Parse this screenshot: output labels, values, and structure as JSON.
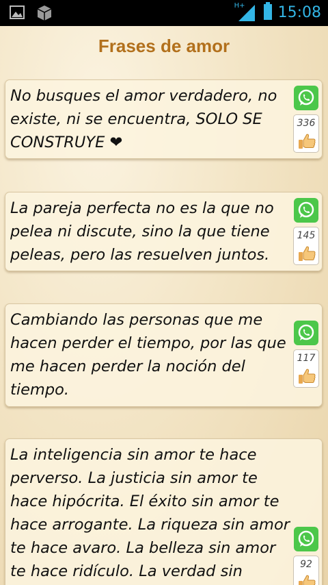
{
  "status_bar": {
    "time": "15:08",
    "network": "H+",
    "icons": [
      "image-icon",
      "box-icon",
      "network-h-plus-icon",
      "signal-icon",
      "battery-icon"
    ]
  },
  "title": "Frases de amor",
  "colors": {
    "title": "#b2701c",
    "whatsapp": "#4cc74a",
    "time": "#33b5e5"
  },
  "phrases": [
    {
      "text": "No busques el amor verdadero, no existe, ni se encuentra, SOLO SE CONSTRUYE",
      "suffix": "❤",
      "likes": "336"
    },
    {
      "text": "La pareja perfecta no es la que no pelea ni discute, sino la que tiene peleas, pero las resuelven juntos.",
      "suffix": "",
      "likes": "145"
    },
    {
      "text": "Cambiando las personas que me hacen perder el tiempo, por las que me hacen perder la noción del tiempo.",
      "suffix": "",
      "likes": "117"
    },
    {
      "text": "La inteligencia sin amor te hace perverso. La justicia sin amor te hace hipócrita. El éxito sin amor te hace arrogante. La riqueza sin amor te hace avaro. La belleza sin amor te hace ridículo. La verdad sin",
      "suffix": "",
      "likes": "92"
    }
  ]
}
